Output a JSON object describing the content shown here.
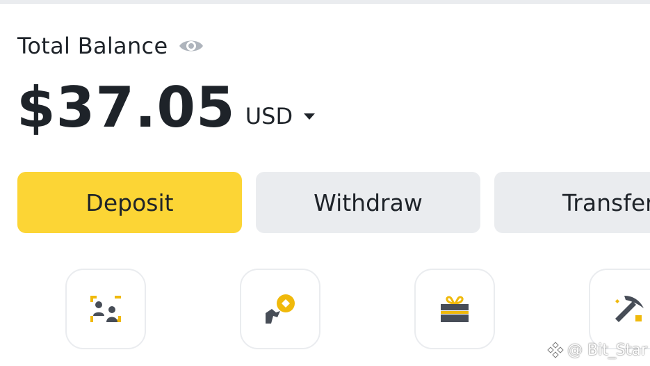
{
  "balance": {
    "label": "Total Balance",
    "amount": "$37.05",
    "currency": "USD"
  },
  "actions": {
    "deposit": "Deposit",
    "withdraw": "Withdraw",
    "transfer": "Transfer"
  },
  "watermark": "@ Bit_Star",
  "colors": {
    "primary_yellow": "#fcd535",
    "secondary_gray": "#eaecef",
    "text_dark": "#1e2329",
    "icon_gray": "#474d57",
    "icon_eye": "#aeb4bc"
  },
  "icons": [
    "eye-icon",
    "caret-down-icon",
    "p2p-icon",
    "buy-crypto-icon",
    "gift-card-icon",
    "mining-pickaxe-icon",
    "watermark-logo-icon"
  ]
}
